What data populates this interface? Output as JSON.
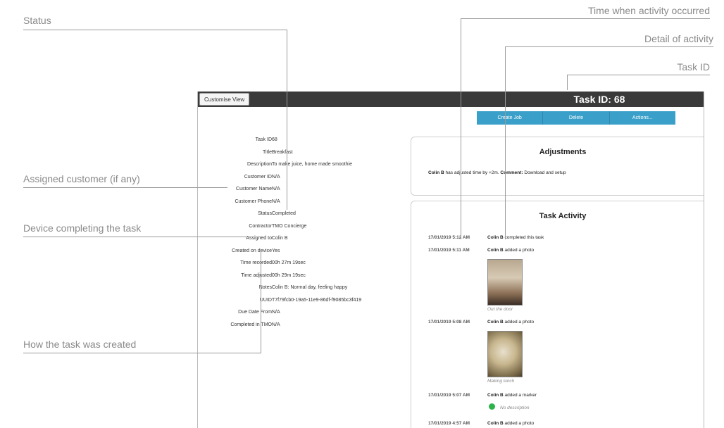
{
  "annotations": {
    "status": "Status",
    "time_when": "Time when activity occurred",
    "detail_of_activity": "Detail of activity",
    "task_id": "Task ID",
    "assigned_customer": "Assigned customer (if any)",
    "device_completing": "Device completing the task",
    "how_created": "How the task was created"
  },
  "toolbar": {
    "customise_label": "Customise View",
    "task_title": "Task ID: 68"
  },
  "actions": {
    "create_job": "Create Job",
    "delete": "Delete",
    "actions": "Actions..."
  },
  "details": [
    {
      "label": "Task ID",
      "value": "68"
    },
    {
      "label": "Title",
      "value": "Breakfast"
    },
    {
      "label": "Description",
      "value": "To make juice, home made smoothie"
    },
    {
      "label": "Customer ID",
      "value": "N/A"
    },
    {
      "label": "Customer Name",
      "value": "N/A"
    },
    {
      "label": "Customer Phone",
      "value": "N/A"
    },
    {
      "label": "Status",
      "value": "Completed"
    },
    {
      "label": "Contractor",
      "value": "TMO Concierge"
    },
    {
      "label": "Assigned to",
      "value": "Colin B"
    },
    {
      "label": "Created on device",
      "value": "Yes"
    },
    {
      "label": "Time recorded",
      "value": "00h 27m 19sec"
    },
    {
      "label": "Time adjusted",
      "value": "00h 29m 19sec"
    },
    {
      "label": "Notes",
      "value": "Colin B: Normal day, feeling happy"
    },
    {
      "label": "UUID",
      "value": "T7f79fcb0-19a5-11e9-86df-f9085bc3f419"
    },
    {
      "label": "Due Date From",
      "value": "N/A"
    },
    {
      "label": "Completed in TMO",
      "value": "N/A"
    }
  ],
  "adjustments": {
    "title": "Adjustments",
    "user": "Colin B",
    "text_mid": " has adjusted time by +2m. ",
    "comment_label": "Comment:",
    "comment_value": " Download and setup"
  },
  "activity": {
    "title": "Task Activity",
    "items": [
      {
        "time": "17/01/2019 5:12 AM",
        "user": "Colin B",
        "text": " completed this task"
      },
      {
        "time": "17/01/2019 5:11 AM",
        "user": "Colin B",
        "text": " added a photo",
        "caption": "Out the door"
      },
      {
        "time": "17/01/2019 5:08 AM",
        "user": "Colin B",
        "text": " added a photo",
        "caption": "Making lunch"
      },
      {
        "time": "17/01/2019 5:07 AM",
        "user": "Colin B",
        "text": " added a marker",
        "marker_text": "No description"
      },
      {
        "time": "17/01/2019 4:57 AM",
        "user": "Colin B",
        "text": " added a photo"
      }
    ]
  },
  "colors": {
    "topbar": "#3a3a3a",
    "action_bar": "#3aa0c9",
    "marker": "#2db34a"
  }
}
